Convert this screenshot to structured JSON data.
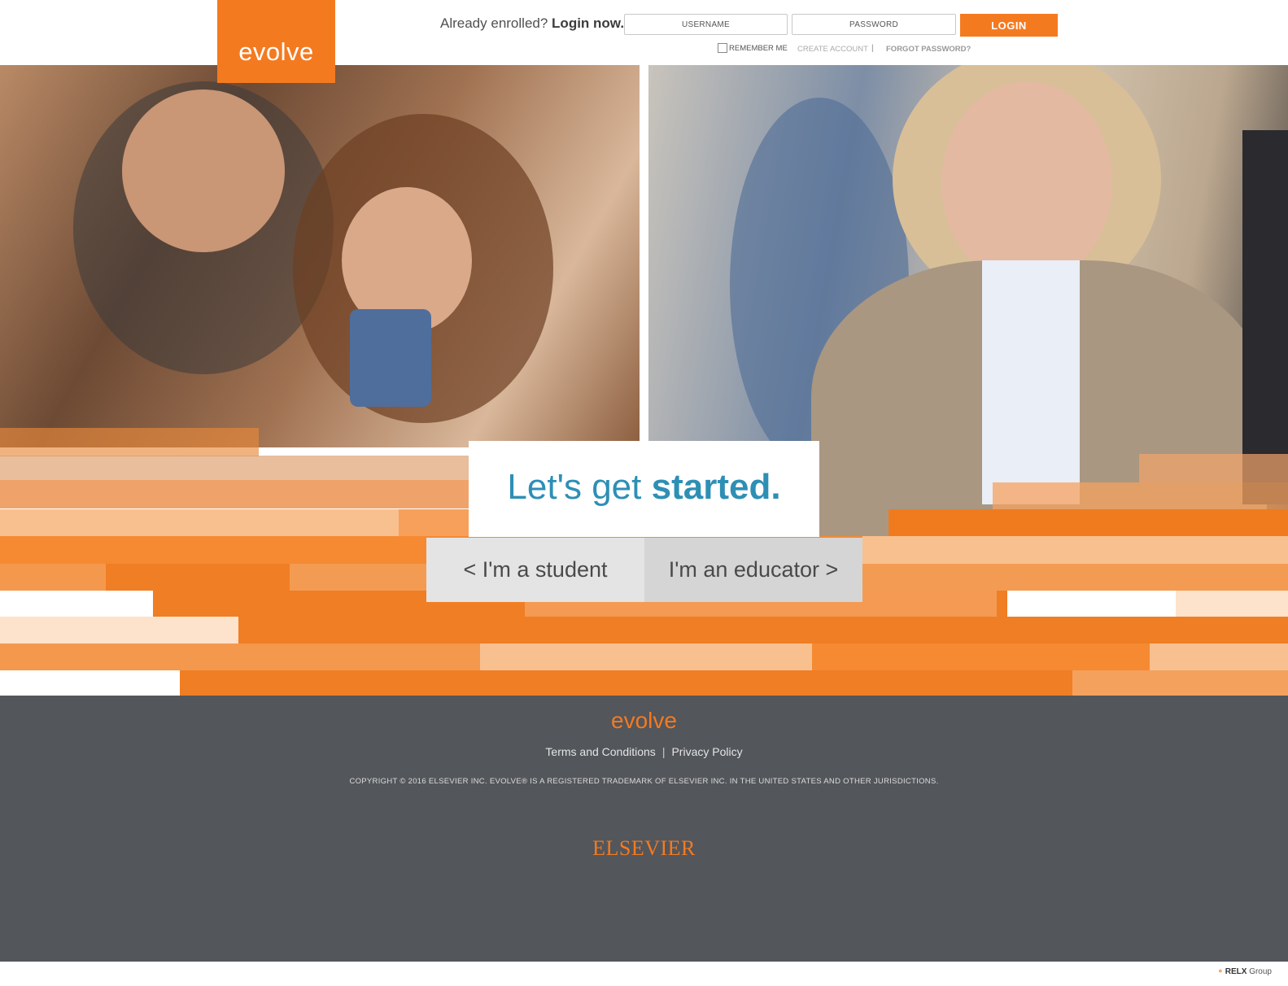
{
  "header": {
    "logo": "evolve",
    "enrolled_prefix": "Already enrolled?",
    "enrolled_cta": "Login now.",
    "username_placeholder": "USERNAME",
    "password_placeholder": "PASSWORD",
    "login_label": "LOGIN",
    "remember_label": "REMEMBER ME",
    "create_account": "CREATE ACCOUNT",
    "separator": "|",
    "forgot_password": "FORGOT PASSWORD?"
  },
  "hero": {
    "title_light": "Let's get ",
    "title_bold": "started.",
    "student_button": "< I'm a student",
    "educator_button": "I'm an educator >"
  },
  "footer": {
    "logo": "evolve",
    "terms": "Terms and Conditions",
    "pipe": "|",
    "privacy": "Privacy Policy",
    "copyright": "COPYRIGHT © 2016 ELSEVIER INC. EVOLVE® IS A REGISTERED TRADEMARK OF ELSEVIER INC. IN THE UNITED STATES AND OTHER JURISDICTIONS.",
    "elsevier": "ELSEVIER"
  },
  "corner": {
    "relx_bold": "RELX",
    "relx_rest": " Group"
  },
  "colors": {
    "brand_orange": "#f47a20",
    "title_blue": "#2e8fb5",
    "footer_gray": "#53565b"
  }
}
